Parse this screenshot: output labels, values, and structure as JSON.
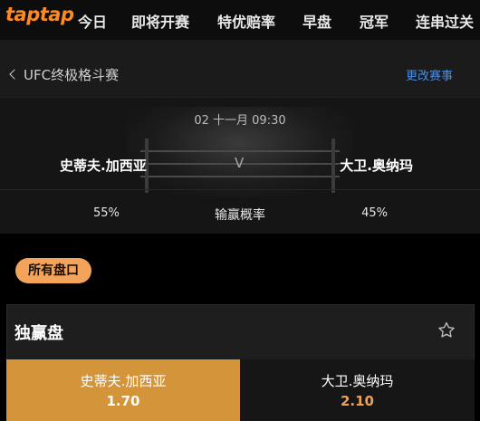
{
  "brand": {
    "logo_text": "taptap"
  },
  "nav": {
    "items": [
      {
        "label": "今日"
      },
      {
        "label": "即将开赛"
      },
      {
        "label": "特优赔率"
      },
      {
        "label": "早盘"
      },
      {
        "label": "冠军"
      },
      {
        "label": "连串过关"
      }
    ]
  },
  "header": {
    "back_label": "UFC终极格斗赛",
    "change_event_label": "更改赛事"
  },
  "match": {
    "datetime": "02 十一月 09:30",
    "team_a": "史蒂夫.加西亚",
    "vs": "V",
    "team_b": "大卫.奥纳玛",
    "prob_label": "输赢概率",
    "prob_a": "55%",
    "prob_b": "45%"
  },
  "tabs": {
    "all_markets": "所有盘口"
  },
  "market": {
    "title": "独赢盘",
    "options": [
      {
        "name": "史蒂夫.加西亚",
        "odds": "1.70"
      },
      {
        "name": "大卫.奥纳玛",
        "odds": "2.10"
      }
    ]
  },
  "colors": {
    "accent": "#f3a45a",
    "selected": "#d3943a",
    "link": "#4a8ee8",
    "odds_highlight": "#f0a050"
  }
}
